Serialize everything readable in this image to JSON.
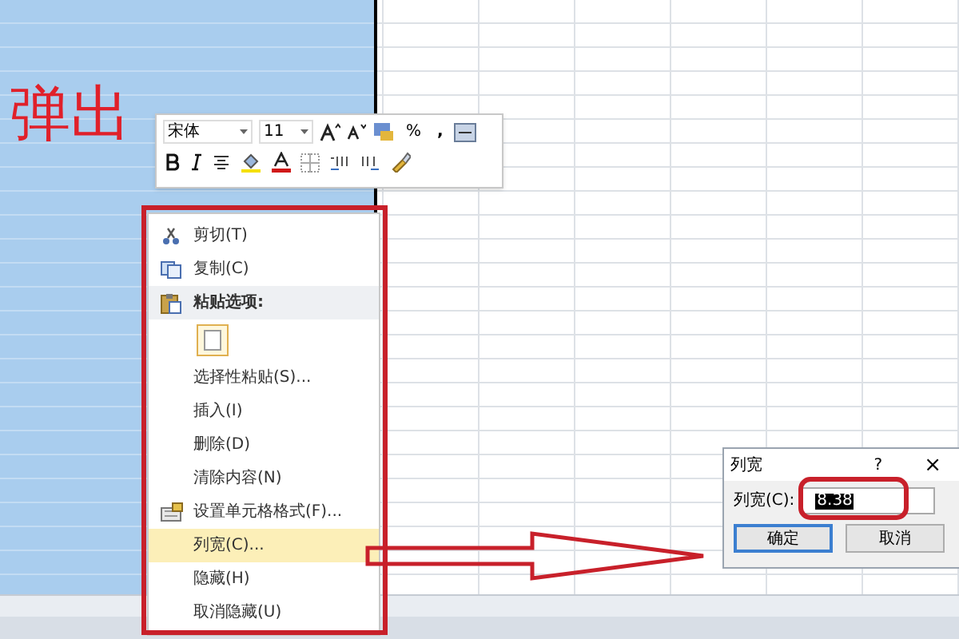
{
  "annotation": {
    "label": "弹出"
  },
  "mini_toolbar": {
    "font": "宋体",
    "size": "11",
    "percent": "%",
    "comma": ","
  },
  "context_menu": {
    "items": [
      {
        "kind": "cut",
        "label": "剪切(T)",
        "selected": false
      },
      {
        "kind": "copy",
        "label": "复制(C)",
        "selected": false
      },
      {
        "kind": "header",
        "label": "粘贴选项:",
        "selected": false
      },
      {
        "kind": "pastebutton",
        "selected": false
      },
      {
        "kind": "plain",
        "label": "选择性粘贴(S)...",
        "selected": false
      },
      {
        "kind": "plain",
        "label": "插入(I)",
        "selected": false
      },
      {
        "kind": "plain",
        "label": "删除(D)",
        "selected": false
      },
      {
        "kind": "plain",
        "label": "清除内容(N)",
        "selected": false
      },
      {
        "kind": "format",
        "label": "设置单元格格式(F)...",
        "selected": false
      },
      {
        "kind": "plain",
        "label": "列宽(C)...",
        "selected": true
      },
      {
        "kind": "plain",
        "label": "隐藏(H)",
        "selected": false
      },
      {
        "kind": "plain",
        "label": "取消隐藏(U)",
        "selected": false
      }
    ]
  },
  "dialog": {
    "title": "列宽",
    "help": "?",
    "close": "×",
    "field_label": "列宽(C):",
    "value": "8.38",
    "buttons": [
      {
        "label": "确定",
        "default": true
      },
      {
        "label": "取消",
        "default": false
      }
    ]
  }
}
